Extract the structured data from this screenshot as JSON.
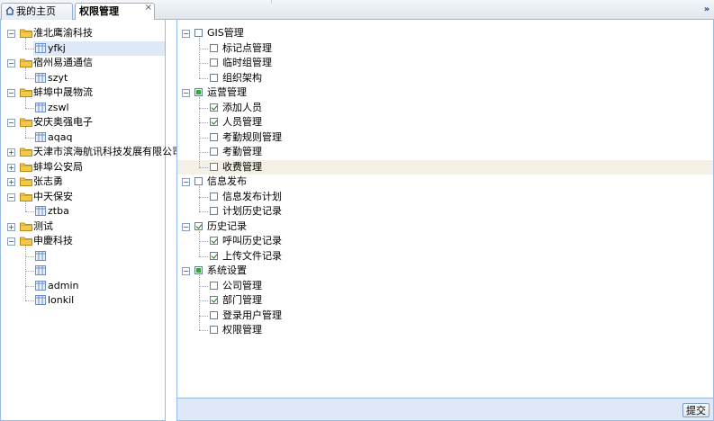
{
  "tabs": [
    {
      "label": "我的主页",
      "icon": "home-icon"
    },
    {
      "label": "权限管理",
      "active": true,
      "close": "×"
    }
  ],
  "tab_scroll": "»",
  "left_tree": [
    {
      "label": "淮北鹰渝科技",
      "expanded": true,
      "children": [
        "yfkj"
      ]
    },
    {
      "label": "宿州易通通信",
      "expanded": true,
      "children": [
        "szyt"
      ]
    },
    {
      "label": "蚌埠中晟物流",
      "expanded": true,
      "children": [
        "zswl"
      ]
    },
    {
      "label": "安庆奥强电子",
      "expanded": true,
      "children": [
        "aqaq"
      ]
    },
    {
      "label": "天津市滨海航讯科技发展有限公司",
      "expanded": false
    },
    {
      "label": "蚌埠公安局",
      "expanded": false
    },
    {
      "label": "张志勇",
      "expanded": false
    },
    {
      "label": "中天保安",
      "expanded": true,
      "children": [
        "ztba"
      ]
    },
    {
      "label": "测试",
      "expanded": false
    },
    {
      "label": "申慶科技",
      "expanded": true,
      "children": [
        "",
        "",
        "admin",
        "lonkil"
      ]
    }
  ],
  "permissions": [
    {
      "label": "GIS管理",
      "state": "unchecked",
      "children": [
        {
          "label": "标记点管理",
          "state": "unchecked"
        },
        {
          "label": "临时组管理",
          "state": "unchecked"
        },
        {
          "label": "组织架构",
          "state": "unchecked"
        }
      ]
    },
    {
      "label": "运营管理",
      "state": "partial",
      "children": [
        {
          "label": "添加人员",
          "state": "checked"
        },
        {
          "label": "人员管理",
          "state": "checked"
        },
        {
          "label": "考勤规则管理",
          "state": "unchecked"
        },
        {
          "label": "考勤管理",
          "state": "unchecked"
        },
        {
          "label": "收费管理",
          "state": "unchecked",
          "highlight": true
        }
      ]
    },
    {
      "label": "信息发布",
      "state": "unchecked",
      "children": [
        {
          "label": "信息发布计划",
          "state": "unchecked"
        },
        {
          "label": "计划历史记录",
          "state": "unchecked"
        }
      ]
    },
    {
      "label": "历史记录",
      "state": "checked",
      "children": [
        {
          "label": "呼叫历史记录",
          "state": "checked"
        },
        {
          "label": "上传文件记录",
          "state": "checked"
        }
      ]
    },
    {
      "label": "系统设置",
      "state": "partial",
      "children": [
        {
          "label": "公司管理",
          "state": "unchecked"
        },
        {
          "label": "部门管理",
          "state": "checked"
        },
        {
          "label": "登录用户管理",
          "state": "unchecked"
        },
        {
          "label": "权限管理",
          "state": "unchecked"
        }
      ]
    }
  ],
  "submit_label": "提交",
  "colors": {
    "accent": "#99bbe8",
    "selected_row": "#dfe8f6",
    "folder": "#f2c94c",
    "check": "#16760f"
  }
}
